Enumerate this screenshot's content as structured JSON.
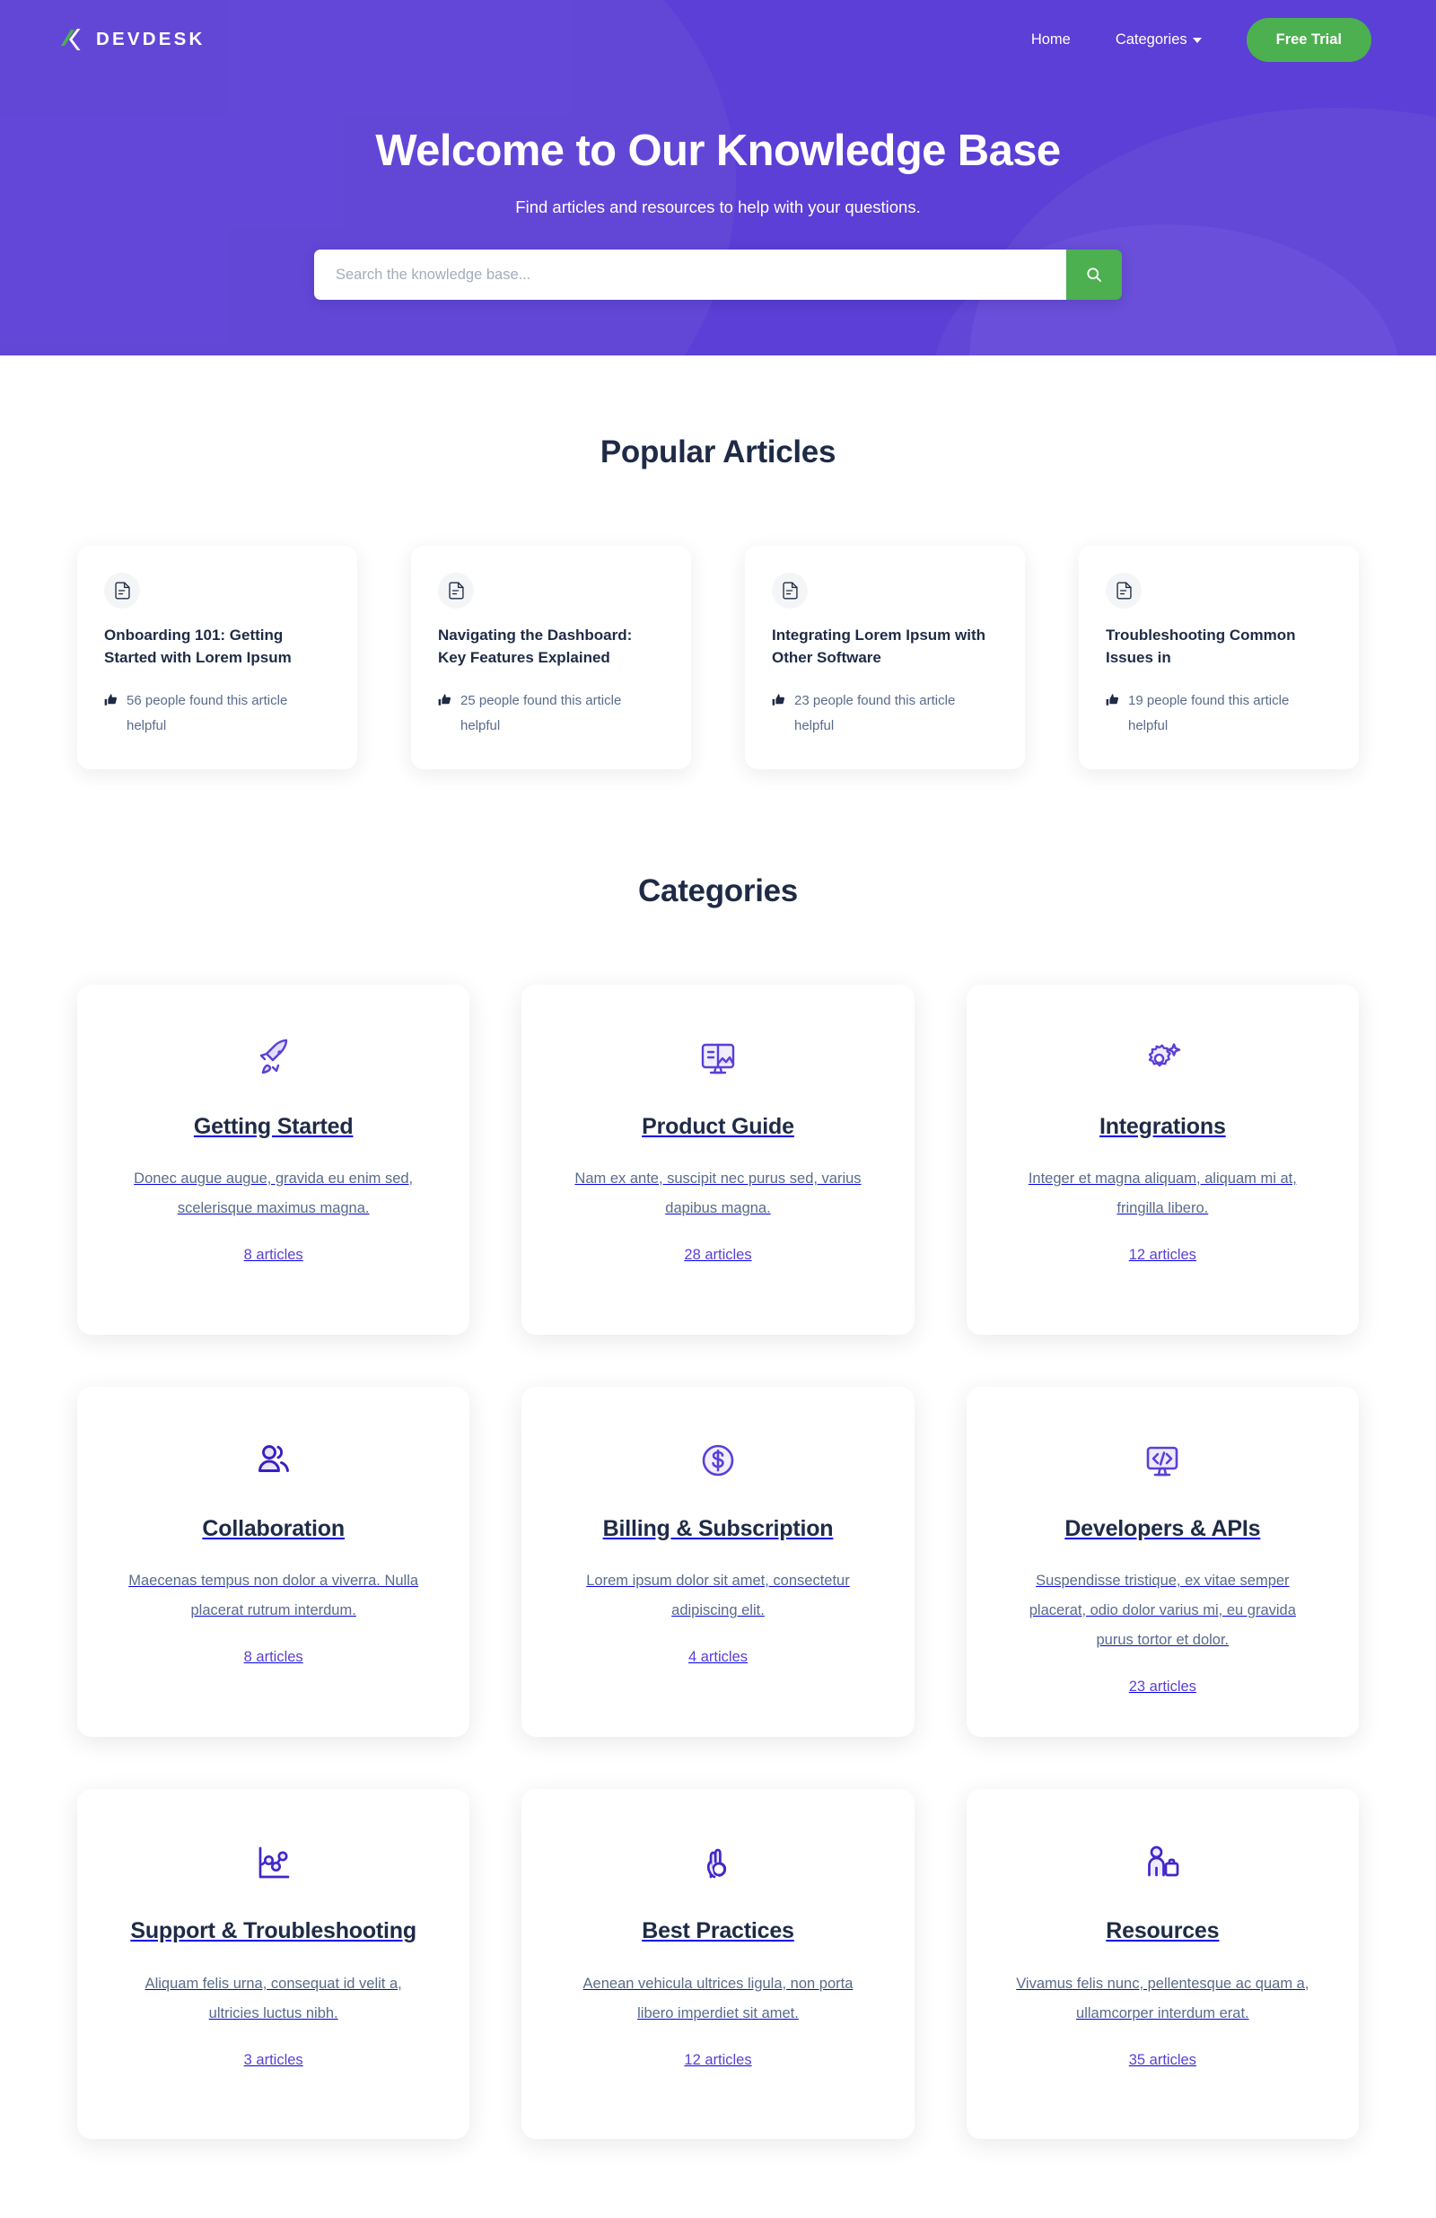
{
  "brand": {
    "name": "DEVDESK",
    "logo_icon": "devdesk-logo-mark"
  },
  "nav": {
    "links": [
      {
        "label": "Home",
        "icon": null
      },
      {
        "label": "Categories",
        "icon": "chevron-down-icon"
      }
    ],
    "cta_label": "Free Trial",
    "cta_color": "#4caf50"
  },
  "hero": {
    "title": "Welcome to Our Knowledge Base",
    "subtitle": "Find articles and resources to help with your questions.",
    "background_color": "#5b3fd6",
    "search": {
      "placeholder": "Search the knowledge base...",
      "value": "",
      "button_icon": "search-icon"
    }
  },
  "popular": {
    "heading": "Popular Articles",
    "articles": [
      {
        "icon": "document-icon",
        "title": "Onboarding 101: Getting Started with Lorem Ipsum",
        "helpful": "56 people found this article helpful",
        "helpful_icon": "thumbs-up-icon"
      },
      {
        "icon": "document-icon",
        "title": "Navigating the Dashboard: Key Features Explained",
        "helpful": "25 people found this article helpful",
        "helpful_icon": "thumbs-up-icon"
      },
      {
        "icon": "document-icon",
        "title": "Integrating Lorem Ipsum with Other Software",
        "helpful": "23 people found this article helpful",
        "helpful_icon": "thumbs-up-icon"
      },
      {
        "icon": "document-icon",
        "title": "Troubleshooting Common Issues in",
        "helpful": "19 people found this article helpful",
        "helpful_icon": "thumbs-up-icon"
      }
    ]
  },
  "categories": {
    "heading": "Categories",
    "accent_color": "#5b3fd6",
    "items": [
      {
        "icon": "rocket-icon",
        "title": "Getting Started",
        "description": "Donec augue augue, gravida eu enim sed, scelerisque maximus magna.",
        "count_label": "8 articles"
      },
      {
        "icon": "monitor-content-icon",
        "title": "Product Guide",
        "description": "Nam ex ante, suscipit nec purus sed, varius dapibus magna.",
        "count_label": "28 articles"
      },
      {
        "icon": "gear-sparkle-icon",
        "title": "Integrations",
        "description": "Integer et magna aliquam, aliquam mi at, fringilla libero.",
        "count_label": "12 articles"
      },
      {
        "icon": "users-icon",
        "title": "Collaboration",
        "description": "Maecenas tempus non dolor a viverra. Nulla placerat rutrum interdum.",
        "count_label": "8 articles"
      },
      {
        "icon": "dollar-circle-icon",
        "title": "Billing & Subscription",
        "description": "Lorem ipsum dolor sit amet, consectetur adipiscing elit.",
        "count_label": "4 articles"
      },
      {
        "icon": "code-monitor-icon",
        "title": "Developers & APIs",
        "description": "Suspendisse tristique, ex vitae semper placerat, odio dolor varius mi, eu gravida purus tortor et dolor.",
        "count_label": "23 articles"
      },
      {
        "icon": "chart-nodes-icon",
        "title": "Support & Troubleshooting",
        "description": "Aliquam felis urna, consequat id velit a, ultricies luctus nibh.",
        "count_label": "3 articles"
      },
      {
        "icon": "ok-hand-icon",
        "title": "Best Practices",
        "description": "Aenean vehicula ultrices ligula, non porta libero imperdiet sit amet.",
        "count_label": "12 articles"
      },
      {
        "icon": "person-briefcase-icon",
        "title": "Resources",
        "description": "Vivamus felis nunc, pellentesque ac quam a, ullamcorper interdum erat.",
        "count_label": "35 articles"
      }
    ]
  }
}
